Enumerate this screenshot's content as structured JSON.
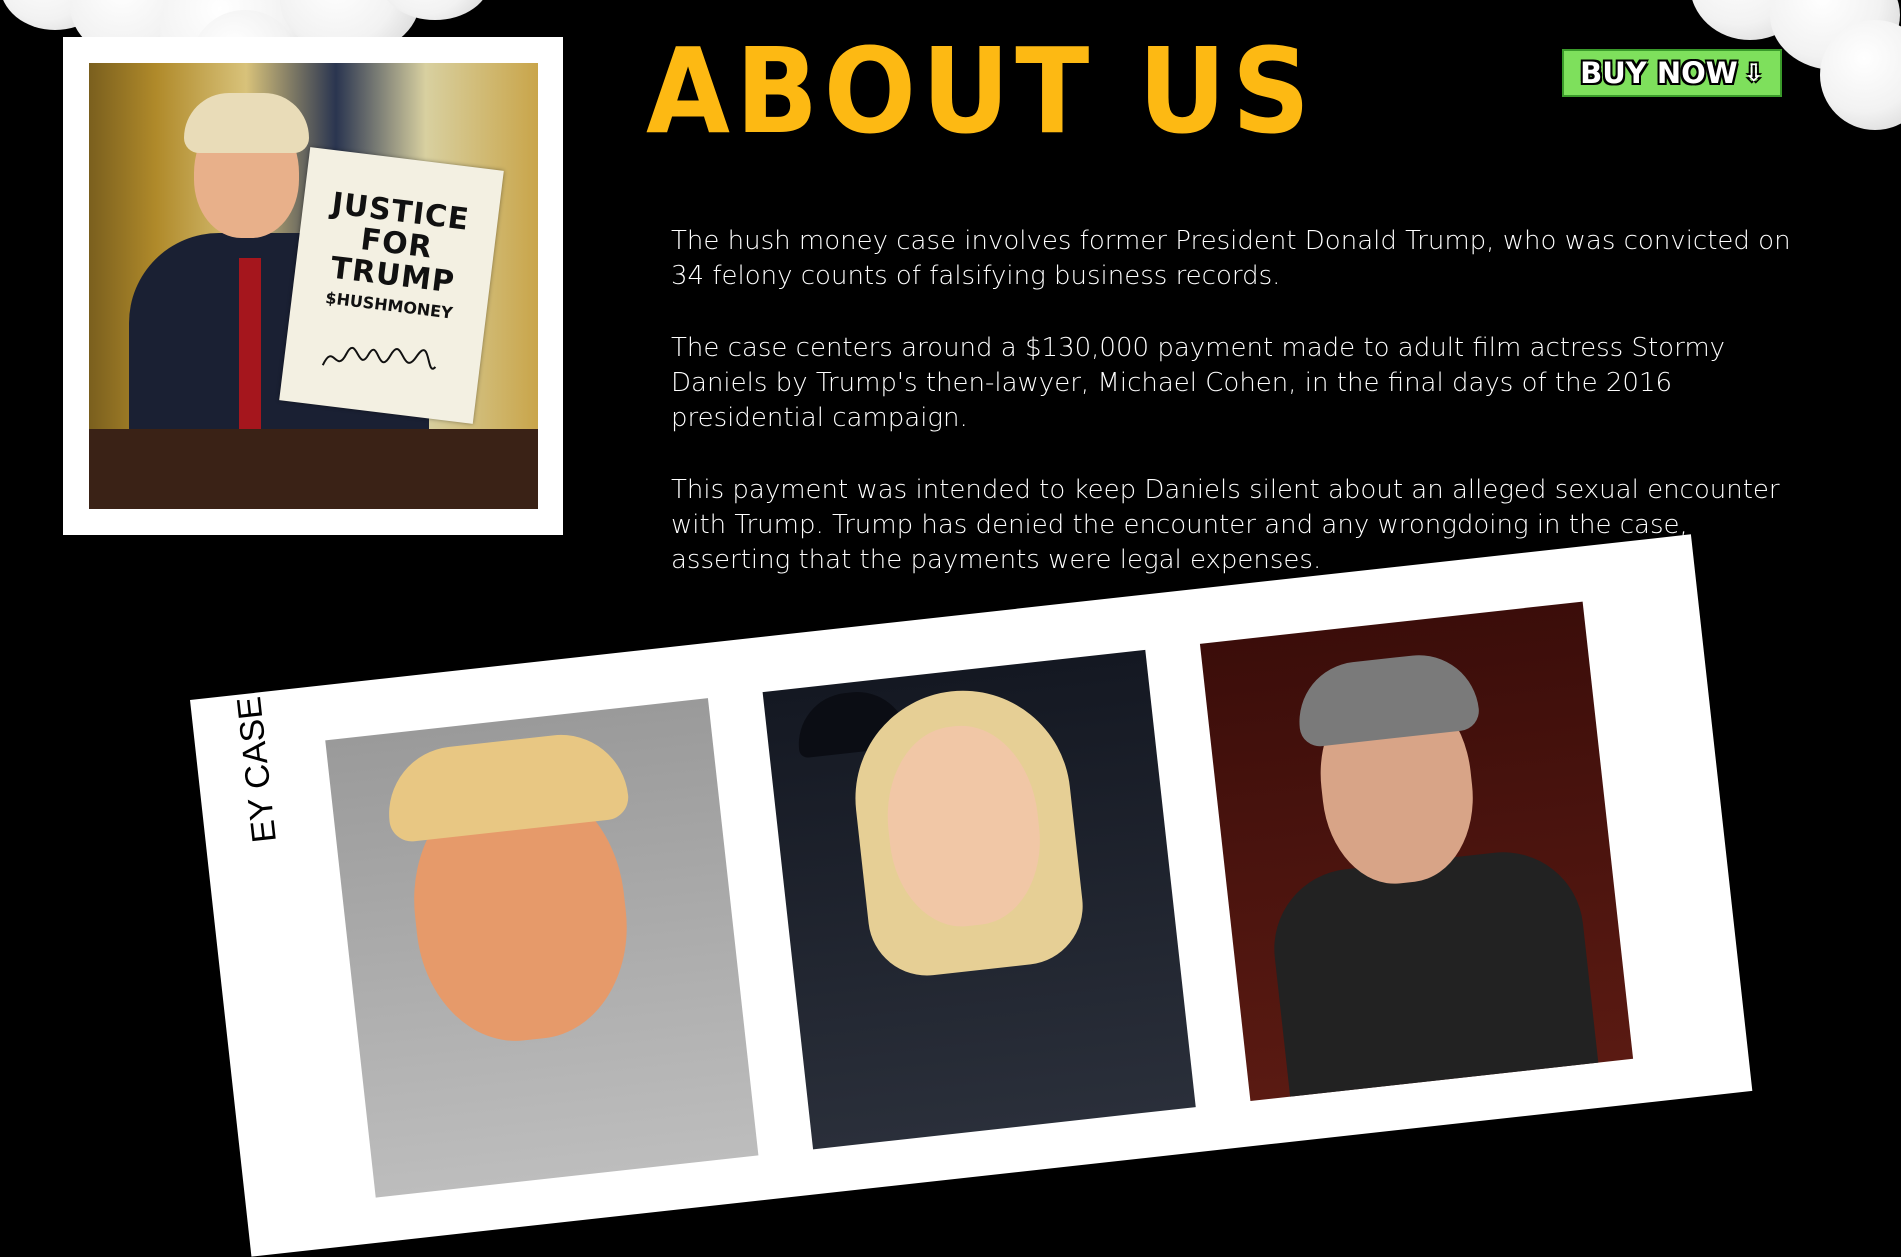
{
  "header": {
    "title": "ABOUT US",
    "buy_button": {
      "label": "BUY NOW",
      "icon": "down-arrow-icon"
    }
  },
  "hero_photo": {
    "sign": {
      "lines": [
        "JUSTICE",
        "FOR",
        "TRUMP"
      ],
      "tag": "$HUSHMONEY",
      "signature": "signature-image"
    }
  },
  "about": {
    "paragraphs": [
      "The hush money case involves former President Donald Trump, who was convicted on 34 felony counts of falsifying business records.",
      "The case centers around a $130,000 payment made to adult film actress Stormy Daniels by Trump's then-lawyer, Michael Cohen, in the final days of the 2016 presidential campaign.",
      "This payment was intended to keep Daniels silent about an alleged sexual encounter with Trump. Trump has denied the encounter and any wrongdoing in the case, asserting that the payments were legal expenses."
    ]
  },
  "photo_strip": {
    "label": "EY CASE"
  },
  "colors": {
    "background": "#000000",
    "title": "#fdb913",
    "button": "#7ee05c",
    "text": "#ffffff"
  }
}
